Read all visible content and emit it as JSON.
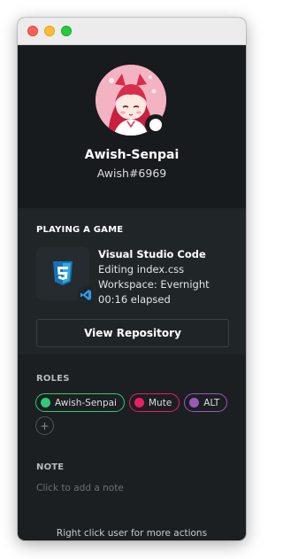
{
  "window": {
    "controls": [
      "close",
      "minimize",
      "zoom"
    ]
  },
  "profile": {
    "username": "Awish-Senpai",
    "discriminator": "Awish#6969",
    "status": "online",
    "status_color": "#ffffff"
  },
  "activity": {
    "heading": "PLAYING A GAME",
    "game_name": "Visual Studio Code",
    "details": "Editing index.css",
    "state": "Workspace: Evernight",
    "elapsed": "00:16 elapsed",
    "large_icon": "css3-icon",
    "small_icon": "vscode-icon",
    "button_label": "View Repository"
  },
  "roles": {
    "heading": "ROLES",
    "items": [
      {
        "name": "Awish-Senpai",
        "color": "#2fcc71"
      },
      {
        "name": "Mute",
        "color": "#e91e63"
      },
      {
        "name": "ALT",
        "color": "#9b59b6"
      }
    ],
    "add_icon": "plus-icon"
  },
  "note": {
    "heading": "NOTE",
    "placeholder": "Click to add a note"
  },
  "footer": "Right click user for more actions"
}
